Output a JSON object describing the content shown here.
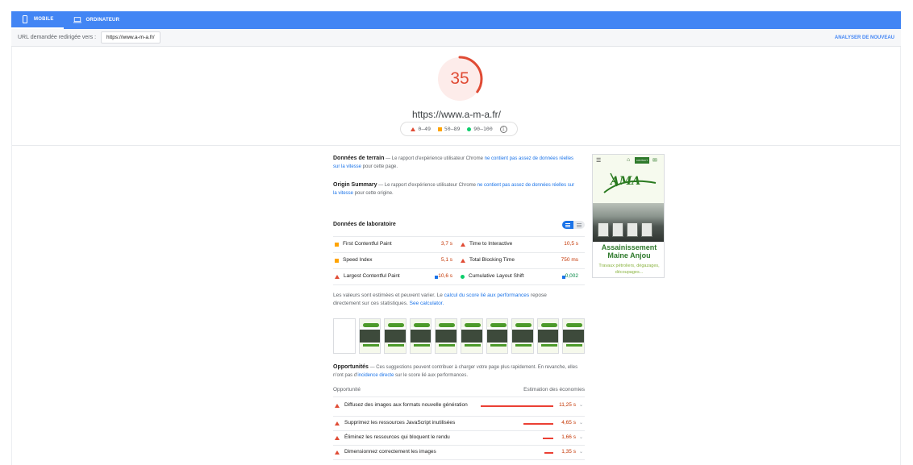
{
  "topbar": {
    "tabs": [
      {
        "label": "MOBILE",
        "icon": "phone-icon",
        "active": true
      },
      {
        "label": "ORDINATEUR",
        "icon": "laptop-icon",
        "active": false
      }
    ]
  },
  "urlbar": {
    "label": "URL demandée redirigée vers :",
    "url": "https://www.a-m-a.fr/",
    "analyze": "ANALYSER DE NOUVEAU"
  },
  "score": {
    "value": "35",
    "fraction": 0.35,
    "url": "https://www.a-m-a.fr/",
    "legend": [
      "0–49",
      "50–89",
      "90–100"
    ],
    "colors": {
      "bad": "#e04b34",
      "avg": "#ffa400",
      "good": "#0cce6b"
    }
  },
  "field": {
    "title": "Données de terrain",
    "text_before": " — Le rapport d'expérience utilisateur Chrome ",
    "link": "ne contient pas assez de données réelles sur la vitesse",
    "text_after": " pour cette page."
  },
  "origin": {
    "title": "Origin Summary",
    "text_before": " — Le rapport d'expérience utilisateur Chrome ",
    "link": "ne contient pas assez de données réelles sur la vitesse",
    "text_after": " pour cette origine."
  },
  "lab": {
    "title": "Données de laboratoire",
    "metrics": [
      [
        {
          "name": "First Contentful Paint",
          "value": "3,7 s",
          "status": "avg"
        },
        {
          "name": "Time to Interactive",
          "value": "10,5 s",
          "status": "bad"
        }
      ],
      [
        {
          "name": "Speed Index",
          "value": "5,1 s",
          "status": "avg"
        },
        {
          "name": "Total Blocking Time",
          "value": "750 ms",
          "status": "bad"
        }
      ],
      [
        {
          "name": "Largest Contentful Paint",
          "value": "10,6 s",
          "status": "bad"
        },
        {
          "name": "Cumulative Layout Shift",
          "value": "0,002",
          "status": "good"
        }
      ]
    ]
  },
  "note": {
    "text1": "Les valeurs sont estimées et peuvent varier. Le ",
    "link1": "calcul du score lié aux performances",
    "text2": " repose directement sur ces statistiques. ",
    "link2": "See calculator."
  },
  "opportunities": {
    "title": "Opportunités",
    "text1": " — Ces suggestions peuvent contribuer à charger votre page plus rapidement. En revanche, elles n'ont pas d'",
    "link": "incidence directe",
    "text2": " sur le score lié aux performances.",
    "col_left": "Opportunité",
    "col_right": "Estimation des économies",
    "items": [
      {
        "label": "Diffusez des images aux formats nouvelle génération",
        "savings": "11,25 s",
        "seconds": 11.25
      },
      {
        "label": "Supprimez les ressources JavaScript inutilisées",
        "savings": "4,65 s",
        "seconds": 4.65
      },
      {
        "label": "Éliminez les ressources qui bloquent le rendu",
        "savings": "1,66 s",
        "seconds": 1.66
      },
      {
        "label": "Dimensionnez correctement les images",
        "savings": "1,35 s",
        "seconds": 1.35
      }
    ]
  },
  "preview": {
    "contact": "CONTACT",
    "logo": "AMA",
    "title": "Assainissement Maine Anjou",
    "subtitle": "Travaux pétroliers, dégazages, découpages..."
  }
}
